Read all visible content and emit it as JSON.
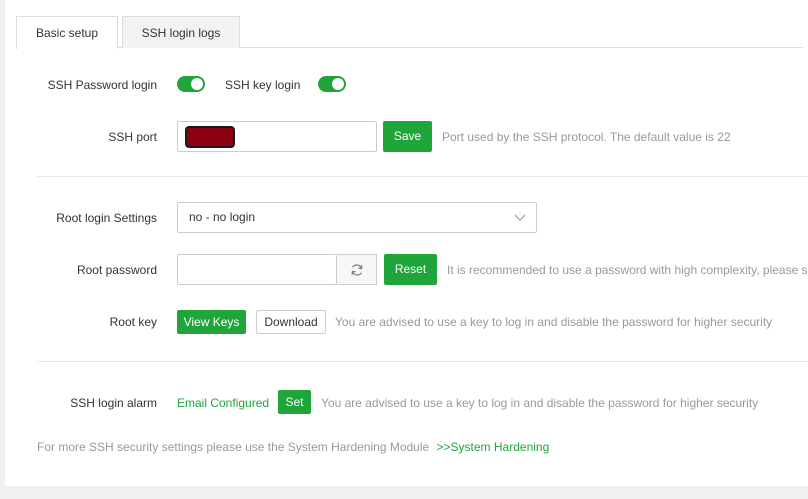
{
  "tabs": [
    {
      "label": "Basic setup",
      "active": true
    },
    {
      "label": "SSH login logs",
      "active": false
    }
  ],
  "ssh_password_login": {
    "label": "SSH Password login",
    "enabled": true
  },
  "ssh_key_login": {
    "label": "SSH key login",
    "enabled": true
  },
  "ssh_port": {
    "label": "SSH port",
    "value": "",
    "save_label": "Save",
    "hint": "Port used by the SSH protocol. The default value is 22"
  },
  "root_login": {
    "label": "Root login Settings",
    "selected": "no - no login"
  },
  "root_password": {
    "label": "Root password",
    "value": "",
    "reset_label": "Reset",
    "hint": "It is recommended to use a password with high complexity, please sa"
  },
  "root_key": {
    "label": "Root key",
    "view_label": "View Keys",
    "download_label": "Download",
    "hint": "You are advised to use a key to log in and disable the password for higher security"
  },
  "ssh_alarm": {
    "label": "SSH login alarm",
    "status": "Email Configured",
    "set_label": "Set",
    "hint": "You are advised to use a key to log in and disable the password for higher security"
  },
  "footer": {
    "text": "For more SSH security settings please use the System Hardening Module",
    "link": ">>System Hardening"
  },
  "colors": {
    "accent": "#20a53a",
    "background": "#f0f0f0",
    "hint": "#999999"
  }
}
